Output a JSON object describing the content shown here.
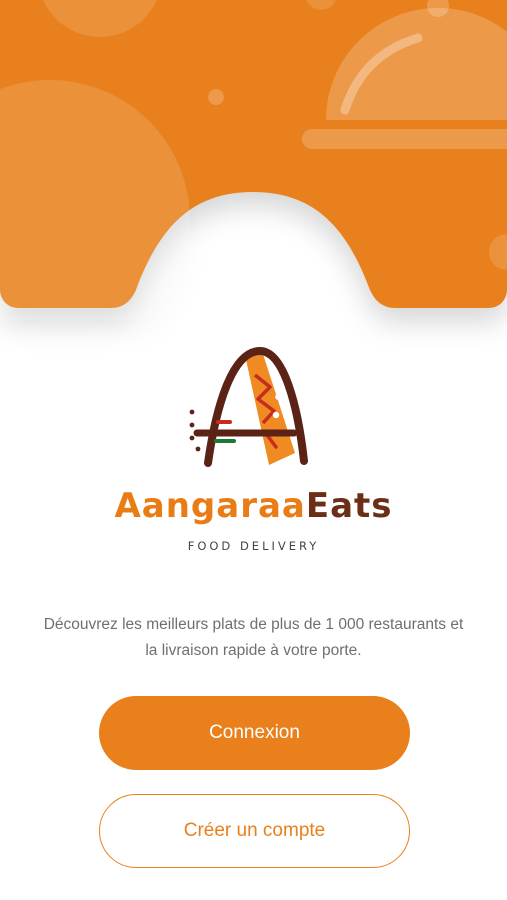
{
  "brand": {
    "name_part1": "Aangaraa",
    "name_part2": "Eats",
    "tagline": "FOOD DELIVERY",
    "logo_icon": "letter-a-pizza-logo-icon",
    "hero_icon": "food-cloche-icon"
  },
  "welcome": {
    "description": "Découvrez les meilleurs plats de plus de 1 000 restaurants et la livraison rapide à votre porte."
  },
  "actions": {
    "login_label": "Connexion",
    "signup_label": "Créer un compte"
  },
  "colors": {
    "primary": "#e9801b",
    "brand_dark": "#6b2f17",
    "text_muted": "#6f6f6f",
    "background": "#ffffff"
  }
}
